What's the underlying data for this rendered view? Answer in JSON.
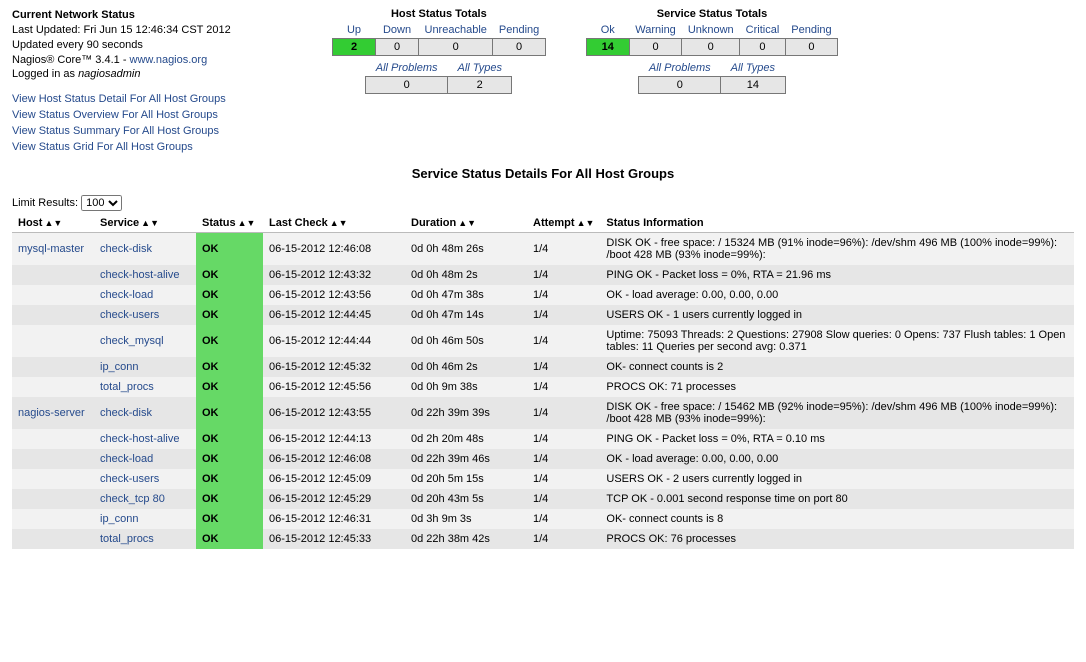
{
  "info": {
    "title": "Current Network Status",
    "last_updated": "Last Updated: Fri Jun 15 12:46:34 CST 2012",
    "update_freq": "Updated every 90 seconds",
    "version_prefix": "Nagios® Core™ 3.4.1 - ",
    "nagios_url_label": "www.nagios.org",
    "logged_in_prefix": "Logged in as ",
    "logged_in_user": "nagiosadmin"
  },
  "nav": {
    "link1": "View Host Status Detail For All Host Groups",
    "link2": "View Status Overview For All Host Groups",
    "link3": "View Status Summary For All Host Groups",
    "link4": "View Status Grid For All Host Groups"
  },
  "host_totals": {
    "title": "Host Status Totals",
    "headers": {
      "up": "Up",
      "down": "Down",
      "unreach": "Unreachable",
      "pending": "Pending"
    },
    "up": "2",
    "down": "0",
    "unreach": "0",
    "pending": "0",
    "sub_headers": {
      "all_problems": "All Problems",
      "all_types": "All Types"
    },
    "all_problems": "0",
    "all_types": "2"
  },
  "service_totals": {
    "title": "Service Status Totals",
    "headers": {
      "ok": "Ok",
      "warning": "Warning",
      "unknown": "Unknown",
      "critical": "Critical",
      "pending": "Pending"
    },
    "ok": "14",
    "warning": "0",
    "unknown": "0",
    "critical": "0",
    "pending": "0",
    "sub_headers": {
      "all_problems": "All Problems",
      "all_types": "All Types"
    },
    "all_problems": "0",
    "all_types": "14"
  },
  "section_title": "Service Status Details For All Host Groups",
  "limit": {
    "label": "Limit Results:",
    "selected": "100"
  },
  "columns": {
    "host": "Host",
    "service": "Service",
    "status": "Status",
    "last_check": "Last Check",
    "duration": "Duration",
    "attempt": "Attempt",
    "status_info": "Status Information"
  },
  "rows": [
    {
      "host": "mysql-master",
      "service": "check-disk",
      "status": "OK",
      "last_check": "06-15-2012 12:46:08",
      "duration": "0d 0h 48m 26s",
      "attempt": "1/4",
      "info": "DISK OK - free space: / 15324 MB (91% inode=96%): /dev/shm 496 MB (100% inode=99%): /boot 428 MB (93% inode=99%):"
    },
    {
      "host": "",
      "service": "check-host-alive",
      "status": "OK",
      "last_check": "06-15-2012 12:43:32",
      "duration": "0d 0h 48m 2s",
      "attempt": "1/4",
      "info": "PING OK - Packet loss = 0%, RTA = 21.96 ms"
    },
    {
      "host": "",
      "service": "check-load",
      "status": "OK",
      "last_check": "06-15-2012 12:43:56",
      "duration": "0d 0h 47m 38s",
      "attempt": "1/4",
      "info": "OK - load average: 0.00, 0.00, 0.00"
    },
    {
      "host": "",
      "service": "check-users",
      "status": "OK",
      "last_check": "06-15-2012 12:44:45",
      "duration": "0d 0h 47m 14s",
      "attempt": "1/4",
      "info": "USERS OK - 1 users currently logged in"
    },
    {
      "host": "",
      "service": "check_mysql",
      "status": "OK",
      "last_check": "06-15-2012 12:44:44",
      "duration": "0d 0h 46m 50s",
      "attempt": "1/4",
      "info": "Uptime: 75093 Threads: 2 Questions: 27908 Slow queries: 0 Opens: 737 Flush tables: 1 Open tables: 11 Queries per second avg: 0.371"
    },
    {
      "host": "",
      "service": "ip_conn",
      "status": "OK",
      "last_check": "06-15-2012 12:45:32",
      "duration": "0d 0h 46m 2s",
      "attempt": "1/4",
      "info": "OK- connect counts is 2"
    },
    {
      "host": "",
      "service": "total_procs",
      "status": "OK",
      "last_check": "06-15-2012 12:45:56",
      "duration": "0d 0h 9m 38s",
      "attempt": "1/4",
      "info": "PROCS OK: 71 processes"
    },
    {
      "host": "nagios-server",
      "service": "check-disk",
      "status": "OK",
      "last_check": "06-15-2012 12:43:55",
      "duration": "0d 22h 39m 39s",
      "attempt": "1/4",
      "info": "DISK OK - free space: / 15462 MB (92% inode=95%): /dev/shm 496 MB (100% inode=99%): /boot 428 MB (93% inode=99%):"
    },
    {
      "host": "",
      "service": "check-host-alive",
      "status": "OK",
      "last_check": "06-15-2012 12:44:13",
      "duration": "0d 2h 20m 48s",
      "attempt": "1/4",
      "info": "PING OK - Packet loss = 0%, RTA = 0.10 ms"
    },
    {
      "host": "",
      "service": "check-load",
      "status": "OK",
      "last_check": "06-15-2012 12:46:08",
      "duration": "0d 22h 39m 46s",
      "attempt": "1/4",
      "info": "OK - load average: 0.00, 0.00, 0.00"
    },
    {
      "host": "",
      "service": "check-users",
      "status": "OK",
      "last_check": "06-15-2012 12:45:09",
      "duration": "0d 20h 5m 15s",
      "attempt": "1/4",
      "info": "USERS OK - 2 users currently logged in"
    },
    {
      "host": "",
      "service": "check_tcp 80",
      "status": "OK",
      "last_check": "06-15-2012 12:45:29",
      "duration": "0d 20h 43m 5s",
      "attempt": "1/4",
      "info": "TCP OK - 0.001 second response time on port 80"
    },
    {
      "host": "",
      "service": "ip_conn",
      "status": "OK",
      "last_check": "06-15-2012 12:46:31",
      "duration": "0d 3h 9m 3s",
      "attempt": "1/4",
      "info": "OK- connect counts is 8"
    },
    {
      "host": "",
      "service": "total_procs",
      "status": "OK",
      "last_check": "06-15-2012 12:45:33",
      "duration": "0d 22h 38m 42s",
      "attempt": "1/4",
      "info": "PROCS OK: 76 processes"
    }
  ]
}
